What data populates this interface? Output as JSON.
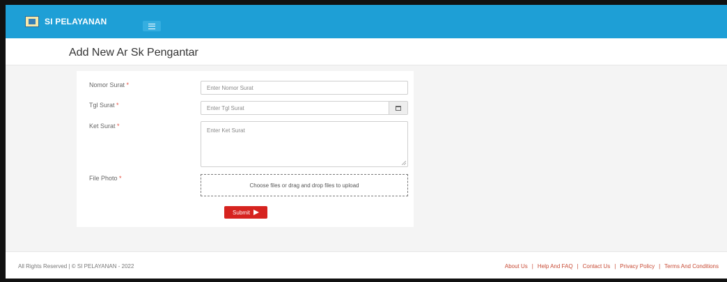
{
  "header": {
    "brand_name": "SI PELAYANAN",
    "brand_color": "#1e9fd6"
  },
  "page": {
    "title": "Add New Ar Sk Pengantar"
  },
  "form": {
    "fields": [
      {
        "label": "Nomor Surat",
        "required_mark": "*",
        "placeholder": "Enter Nomor Surat"
      },
      {
        "label": "Tgl Surat",
        "required_mark": "*",
        "placeholder": "Enter Tgl Surat"
      },
      {
        "label": "Ket Surat",
        "required_mark": "*",
        "placeholder": "Enter Ket Surat"
      },
      {
        "label": "File Photo",
        "required_mark": "*",
        "placeholder": "Choose files or drag and drop files to upload"
      }
    ],
    "submit_label": "Submit",
    "submit_color": "#d6231f"
  },
  "footer": {
    "copyright": "All Rights Reserved | © SI PELAYANAN - 2022",
    "links": [
      "About Us",
      "Help And FAQ",
      "Contact Us",
      "Privacy Policy",
      "Terms And Conditions"
    ],
    "separator": "|",
    "link_color": "#c74a34"
  }
}
